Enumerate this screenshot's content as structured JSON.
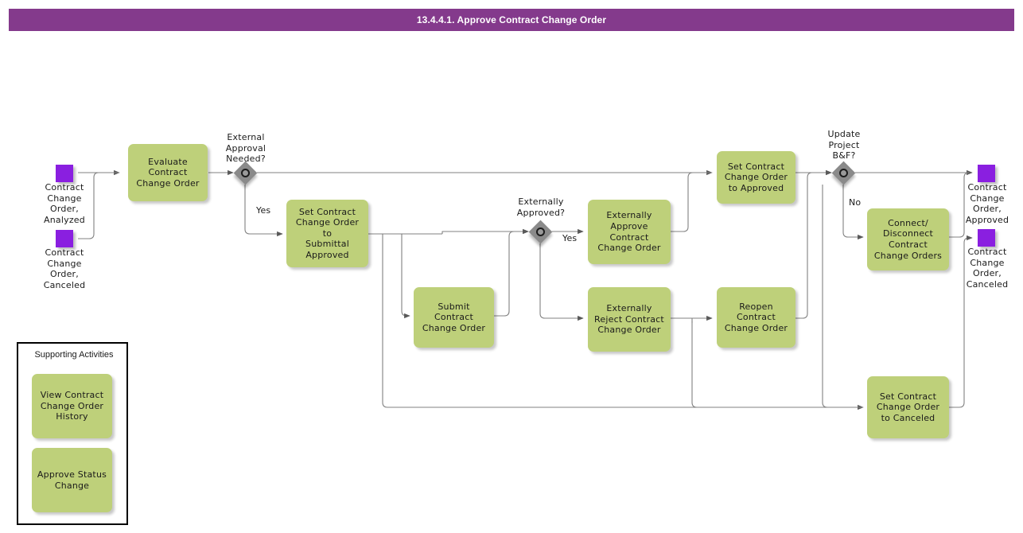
{
  "header": {
    "title": "13.4.4.1. Approve Contract Change Order",
    "bar_color": "#843a8c"
  },
  "palette": {
    "task_fill": "#bed07a",
    "event_fill": "#8a1fe0",
    "gateway_fill": "#8a8a8a",
    "connector": "#595959"
  },
  "events": {
    "start_analyzed": "Contract\nChange\nOrder,\nAnalyzed",
    "start_canceled": "Contract\nChange\nOrder,\nCanceled",
    "end_approved": "Contract\nChange\nOrder,\nApproved",
    "end_canceled": "Contract\nChange\nOrder,\nCanceled"
  },
  "gateways": {
    "external_approval": "External\nApproval\nNeeded?",
    "externally_approved": "Externally\nApproved?",
    "update_project": "Update\nProject\nB&F?"
  },
  "flow_labels": {
    "yes_external": "Yes",
    "yes_externally": "Yes",
    "no_update": "No"
  },
  "tasks": {
    "evaluate": "Evaluate\nContract\nChange Order",
    "set_submittal_approved": "Set Contract\nChange Order to\nSubmittal\nApproved",
    "submit": "Submit\nContract\nChange Order",
    "externally_approve": "Externally\nApprove\nContract\nChange Order",
    "externally_reject": "Externally\nReject Contract\nChange Order",
    "set_approved": "Set Contract\nChange Order\nto Approved",
    "reopen": "Reopen Contract\nChange Order",
    "connect_disconnect": "Connect/\nDisconnect\nContract\nChange Orders",
    "set_canceled": "Set Contract\nChange Order\nto Canceled"
  },
  "supporting_activities": {
    "title": "Supporting Activities",
    "items": [
      {
        "label": "View Contract\nChange Order\nHistory"
      },
      {
        "label": "Approve Status\nChange"
      }
    ]
  }
}
